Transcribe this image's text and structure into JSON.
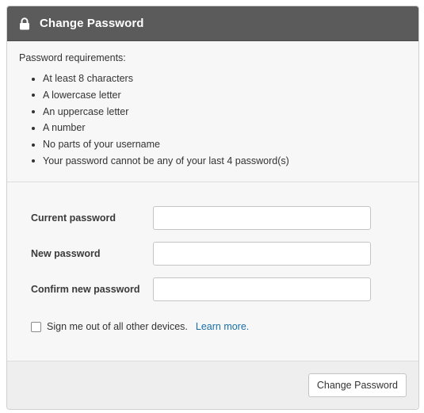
{
  "header": {
    "icon": "lock-icon",
    "title": "Change Password",
    "background_color": "#5b5b5b"
  },
  "requirements": {
    "title": "Password requirements:",
    "items": [
      "At least 8 characters",
      "A lowercase letter",
      "An uppercase letter",
      "A number",
      "No parts of your username",
      "Your password cannot be any of your last 4 password(s)"
    ]
  },
  "form": {
    "fields": [
      {
        "label": "Current password",
        "value": "",
        "placeholder": ""
      },
      {
        "label": "New password",
        "value": "",
        "placeholder": ""
      },
      {
        "label": "Confirm new password",
        "value": "",
        "placeholder": ""
      }
    ],
    "sign_out_checkbox": {
      "label": "Sign me out of all other devices.",
      "checked": false,
      "link_text": "Learn more.",
      "link_color": "#1a6fa4"
    }
  },
  "footer": {
    "submit_label": "Change Password"
  }
}
